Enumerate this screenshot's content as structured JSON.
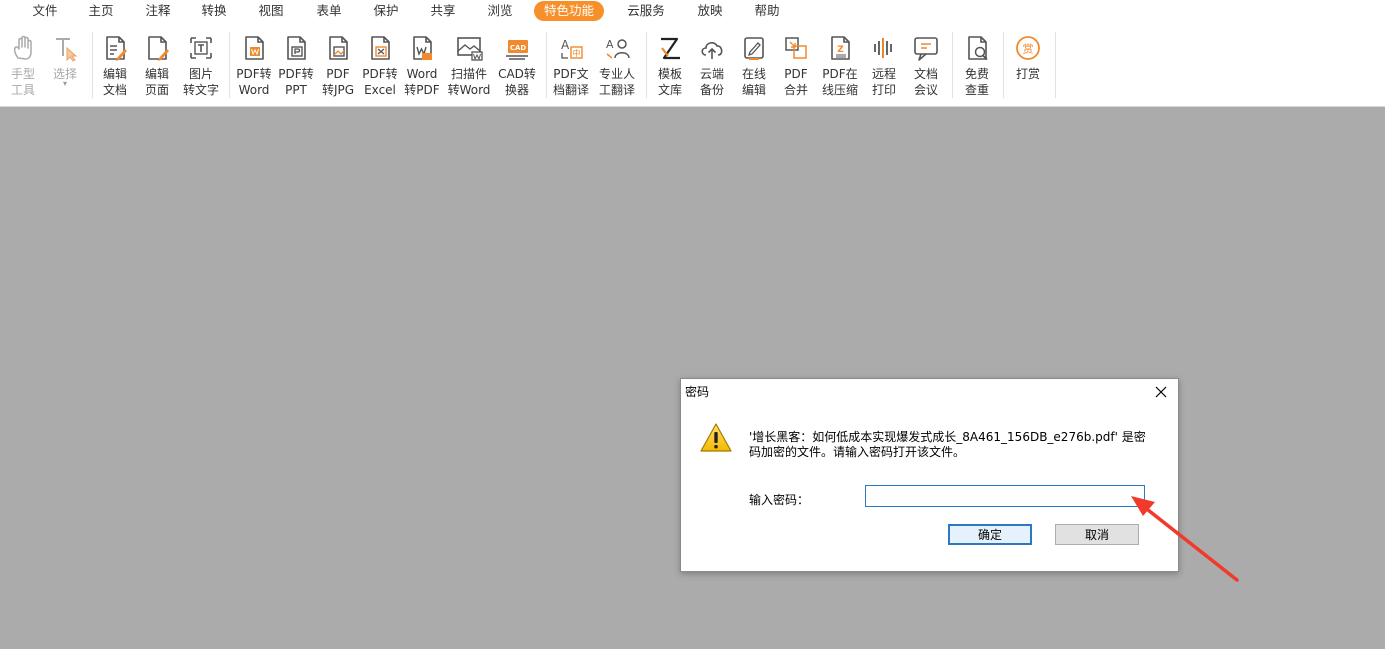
{
  "menu": {
    "items": [
      "文件",
      "主页",
      "注释",
      "转换",
      "视图",
      "表单",
      "保护",
      "共享",
      "浏览",
      "特色功能",
      "云服务",
      "放映",
      "帮助"
    ],
    "active_index": 9
  },
  "toolbar": {
    "tools": [
      {
        "id": "hand",
        "l1": "手型",
        "l2": "工具",
        "icon": "hand-icon",
        "disabled": true
      },
      {
        "id": "select",
        "l1": "选择",
        "l2": "",
        "icon": "text-select-icon",
        "disabled": true,
        "caret": "▾"
      },
      {
        "id": "edit-doc",
        "l1": "编辑",
        "l2": "文档",
        "icon": "edit-document-icon"
      },
      {
        "id": "edit-page",
        "l1": "编辑",
        "l2": "页面",
        "icon": "edit-page-icon"
      },
      {
        "id": "img-text",
        "l1": "图片",
        "l2": "转文字",
        "icon": "image-to-text-icon"
      },
      {
        "id": "pdf-word",
        "l1": "PDF转",
        "l2": "Word",
        "icon": "pdf-to-word-icon"
      },
      {
        "id": "pdf-ppt",
        "l1": "PDF转",
        "l2": "PPT",
        "icon": "pdf-to-ppt-icon"
      },
      {
        "id": "pdf-jpg",
        "l1": "PDF",
        "l2": "转JPG",
        "icon": "pdf-to-jpg-icon"
      },
      {
        "id": "pdf-excel",
        "l1": "PDF转",
        "l2": "Excel",
        "icon": "pdf-to-excel-icon"
      },
      {
        "id": "word-pdf",
        "l1": "Word",
        "l2": "转PDF",
        "icon": "word-to-pdf-icon"
      },
      {
        "id": "scan-word",
        "l1": "扫描件",
        "l2": "转Word",
        "icon": "scan-to-word-icon"
      },
      {
        "id": "cad",
        "l1": "CAD转",
        "l2": "换器",
        "icon": "cad-converter-icon"
      },
      {
        "id": "pdf-translate",
        "l1": "PDF文",
        "l2": "档翻译",
        "icon": "translate-icon"
      },
      {
        "id": "human-translate",
        "l1": "专业人",
        "l2": "工翻译",
        "icon": "human-translate-icon"
      },
      {
        "id": "template",
        "l1": "模板",
        "l2": "文库",
        "icon": "template-icon"
      },
      {
        "id": "cloud-backup",
        "l1": "云端",
        "l2": "备份",
        "icon": "cloud-upload-icon"
      },
      {
        "id": "online-edit",
        "l1": "在线",
        "l2": "编辑",
        "icon": "online-edit-icon"
      },
      {
        "id": "pdf-merge",
        "l1": "PDF",
        "l2": "合并",
        "icon": "merge-icon"
      },
      {
        "id": "pdf-compress",
        "l1": "PDF在",
        "l2": "线压缩",
        "icon": "compress-icon"
      },
      {
        "id": "remote-print",
        "l1": "远程",
        "l2": "打印",
        "icon": "remote-print-icon"
      },
      {
        "id": "meeting",
        "l1": "文档",
        "l2": "会议",
        "icon": "meeting-icon"
      },
      {
        "id": "plagiarism",
        "l1": "免费",
        "l2": "查重",
        "icon": "check-duplicate-icon"
      },
      {
        "id": "reward",
        "l1": "打赏",
        "l2": "",
        "icon": "reward-icon"
      }
    ]
  },
  "dialog": {
    "title": "密码",
    "message": "'增长黑客：如何低成本实现爆发式成长_8A461_156DB_e276b.pdf' 是密码加密的文件。请输入密码打开该文件。",
    "password_label": "输入密码：",
    "password_value": "",
    "ok_label": "确定",
    "cancel_label": "取消"
  },
  "colors": {
    "accent": "#f7902a",
    "icon_orange": "#f08a2c",
    "workspace": "#ababab",
    "arrow": "#f23a2a",
    "input_focus": "#2b79c2"
  }
}
